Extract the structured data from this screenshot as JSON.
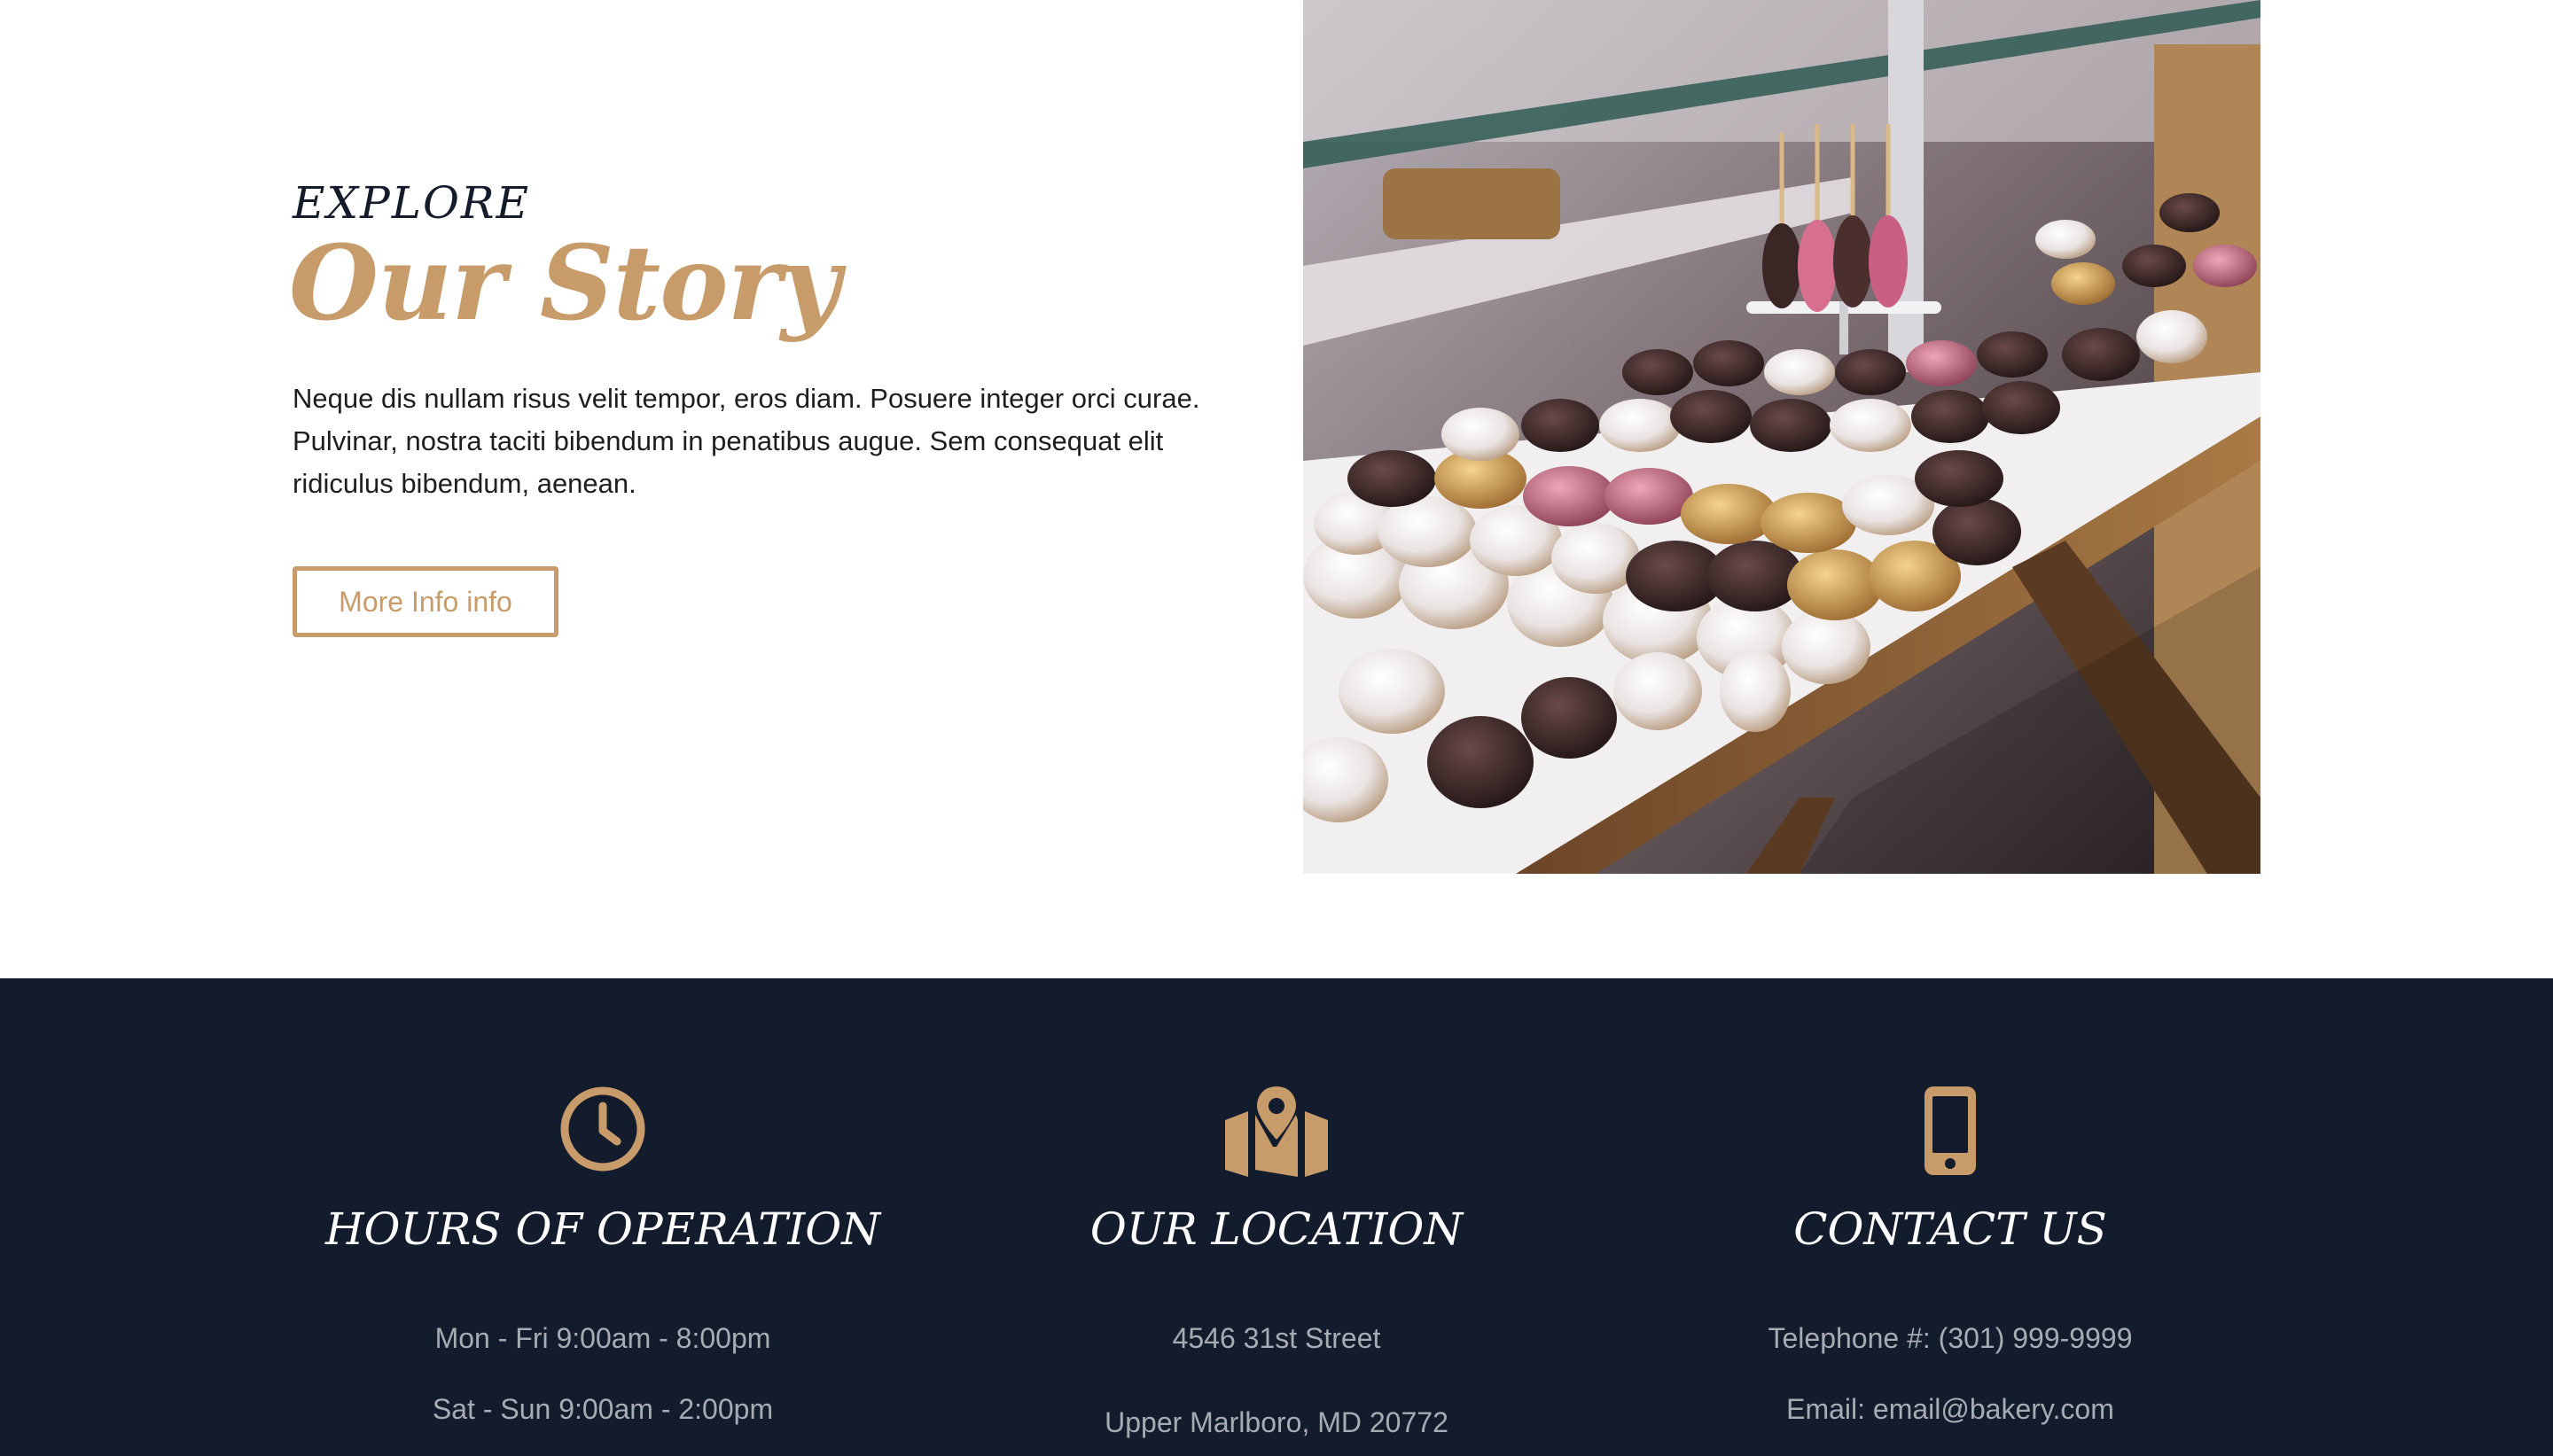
{
  "story": {
    "eyebrow": "EXPLORE",
    "title": "Our Story",
    "paragraph": "Neque dis nullam risus velit tempor, eros diam. Posuere integer orci curae. Pulvinar, nostra taciti bibendum in penatibus augue. Sem consequat elit ridiculus bibendum, aenean.",
    "button_label": "More Info info",
    "image_subject": "bakery-display-case-donuts"
  },
  "info": {
    "hours": {
      "icon": "clock-icon",
      "heading": "HOURS OF OPERATION",
      "lines": [
        "Mon - Fri 9:00am - 8:00pm",
        "Sat - Sun 9:00am - 2:00pm"
      ]
    },
    "location": {
      "icon": "map-pin-icon",
      "heading": "OUR LOCATION",
      "lines": [
        "4546 31st Street",
        "Upper Marlboro, MD 20772"
      ]
    },
    "contact": {
      "icon": "mobile-phone-icon",
      "heading": "CONTACT US",
      "lines": [
        "Telephone #: (301) 999-9999",
        "Email: email@bakery.com"
      ]
    }
  },
  "colors": {
    "accent": "#c79b6a",
    "navy": "#131c2c",
    "muted_text": "#a7abb3",
    "dark_text": "#141c2b"
  }
}
